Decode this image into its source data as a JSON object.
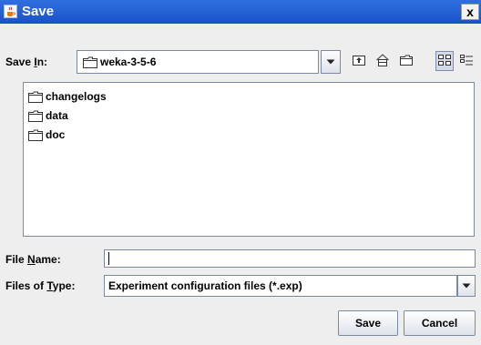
{
  "window": {
    "title": "Save",
    "close_glyph": "x"
  },
  "save_in": {
    "label_pre": "Save ",
    "label_mnemonic": "I",
    "label_post": "n:",
    "current_folder": "weka-3-5-6",
    "folder_icon": "folder-icon"
  },
  "toolbar": {
    "icons": [
      "up-one-level-icon",
      "home-icon",
      "new-folder-icon",
      "list-view-icon",
      "details-view-icon"
    ],
    "selected_view": "list-view"
  },
  "files": [
    {
      "name": "changelogs",
      "icon": "folder-icon"
    },
    {
      "name": "data",
      "icon": "folder-icon"
    },
    {
      "name": "doc",
      "icon": "folder-icon"
    }
  ],
  "file_name": {
    "label_pre": "File ",
    "label_mnemonic": "N",
    "label_post": "ame:",
    "value": ""
  },
  "file_type": {
    "label_pre": "Files of ",
    "label_mnemonic": "T",
    "label_post": "ype:",
    "selected": "Experiment configuration files (*.exp)"
  },
  "buttons": {
    "save": "Save",
    "cancel": "Cancel"
  },
  "colors": {
    "titlebar": "#2463d8",
    "dialog_bg": "#eeeeee",
    "border": "#7a8aa0"
  }
}
